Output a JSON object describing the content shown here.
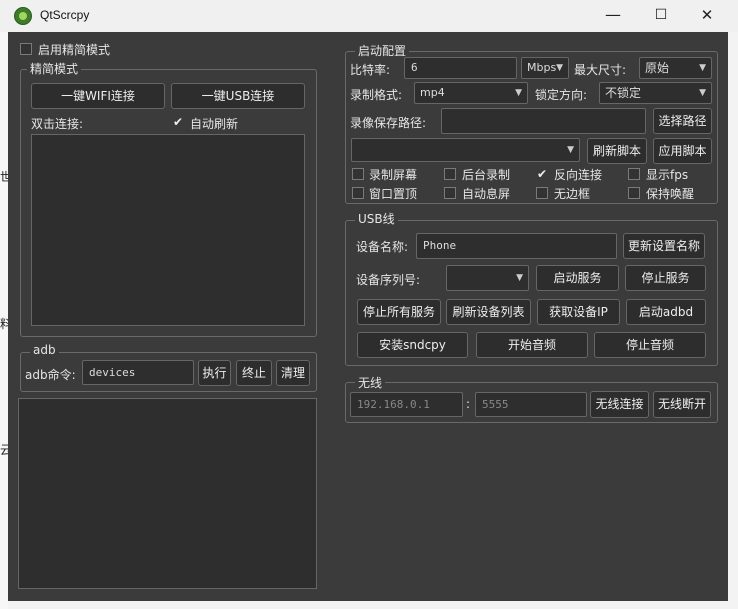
{
  "window": {
    "title": "QtScrcpy",
    "minimize_icon": "—",
    "maximize_icon": "☐",
    "close_icon": "✕"
  },
  "edge_chars": [
    "世",
    "料",
    "云"
  ],
  "simple_mode_toggle": {
    "label": "启用精简模式",
    "checked": false
  },
  "simple_mode": {
    "title": "精简模式",
    "wifi_button": "一键WIFI连接",
    "usb_button": "一键USB连接",
    "double_click_label": "双击连接:",
    "auto_refresh": {
      "label": "自动刷新",
      "checked": true
    }
  },
  "adb": {
    "title": "adb",
    "command_label": "adb命令:",
    "command_value": "devices",
    "execute": "执行",
    "stop": "终止",
    "clear": "清理"
  },
  "start_config": {
    "title": "启动配置",
    "bitrate_label": "比特率:",
    "bitrate_value": "6",
    "bitrate_unit": "Mbps",
    "max_size_label": "最大尺寸:",
    "max_size_value": "原始",
    "record_format_label": "录制格式:",
    "record_format_value": "mp4",
    "lock_orientation_label": "锁定方向:",
    "lock_orientation_value": "不锁定",
    "record_path_label": "录像保存路径:",
    "record_path_value": "",
    "select_path": "选择路径",
    "refresh_script": "刷新脚本",
    "apply_script": "应用脚本",
    "options": [
      {
        "label": "录制屏幕",
        "checked": false
      },
      {
        "label": "后台录制",
        "checked": false
      },
      {
        "label": "反向连接",
        "checked": true
      },
      {
        "label": "显示fps",
        "checked": false
      },
      {
        "label": "窗口置顶",
        "checked": false
      },
      {
        "label": "自动息屏",
        "checked": false
      },
      {
        "label": "无边框",
        "checked": false
      },
      {
        "label": "保持唤醒",
        "checked": false
      }
    ]
  },
  "usb": {
    "title": "USB线",
    "device_name_label": "设备名称:",
    "device_name_value": "Phone",
    "update_name": "更新设置名称",
    "serial_label": "设备序列号:",
    "serial_value": "",
    "start_service": "启动服务",
    "stop_service": "停止服务",
    "stop_all": "停止所有服务",
    "refresh_devices": "刷新设备列表",
    "get_ip": "获取设备IP",
    "start_adbd": "启动adbd",
    "install_sndcpy": "安装sndcpy",
    "start_audio": "开始音频",
    "stop_audio": "停止音频"
  },
  "wireless": {
    "title": "无线",
    "ip_placeholder": "192.168.0.1",
    "separator": ":",
    "port_placeholder": "5555",
    "connect": "无线连接",
    "disconnect": "无线断开"
  }
}
